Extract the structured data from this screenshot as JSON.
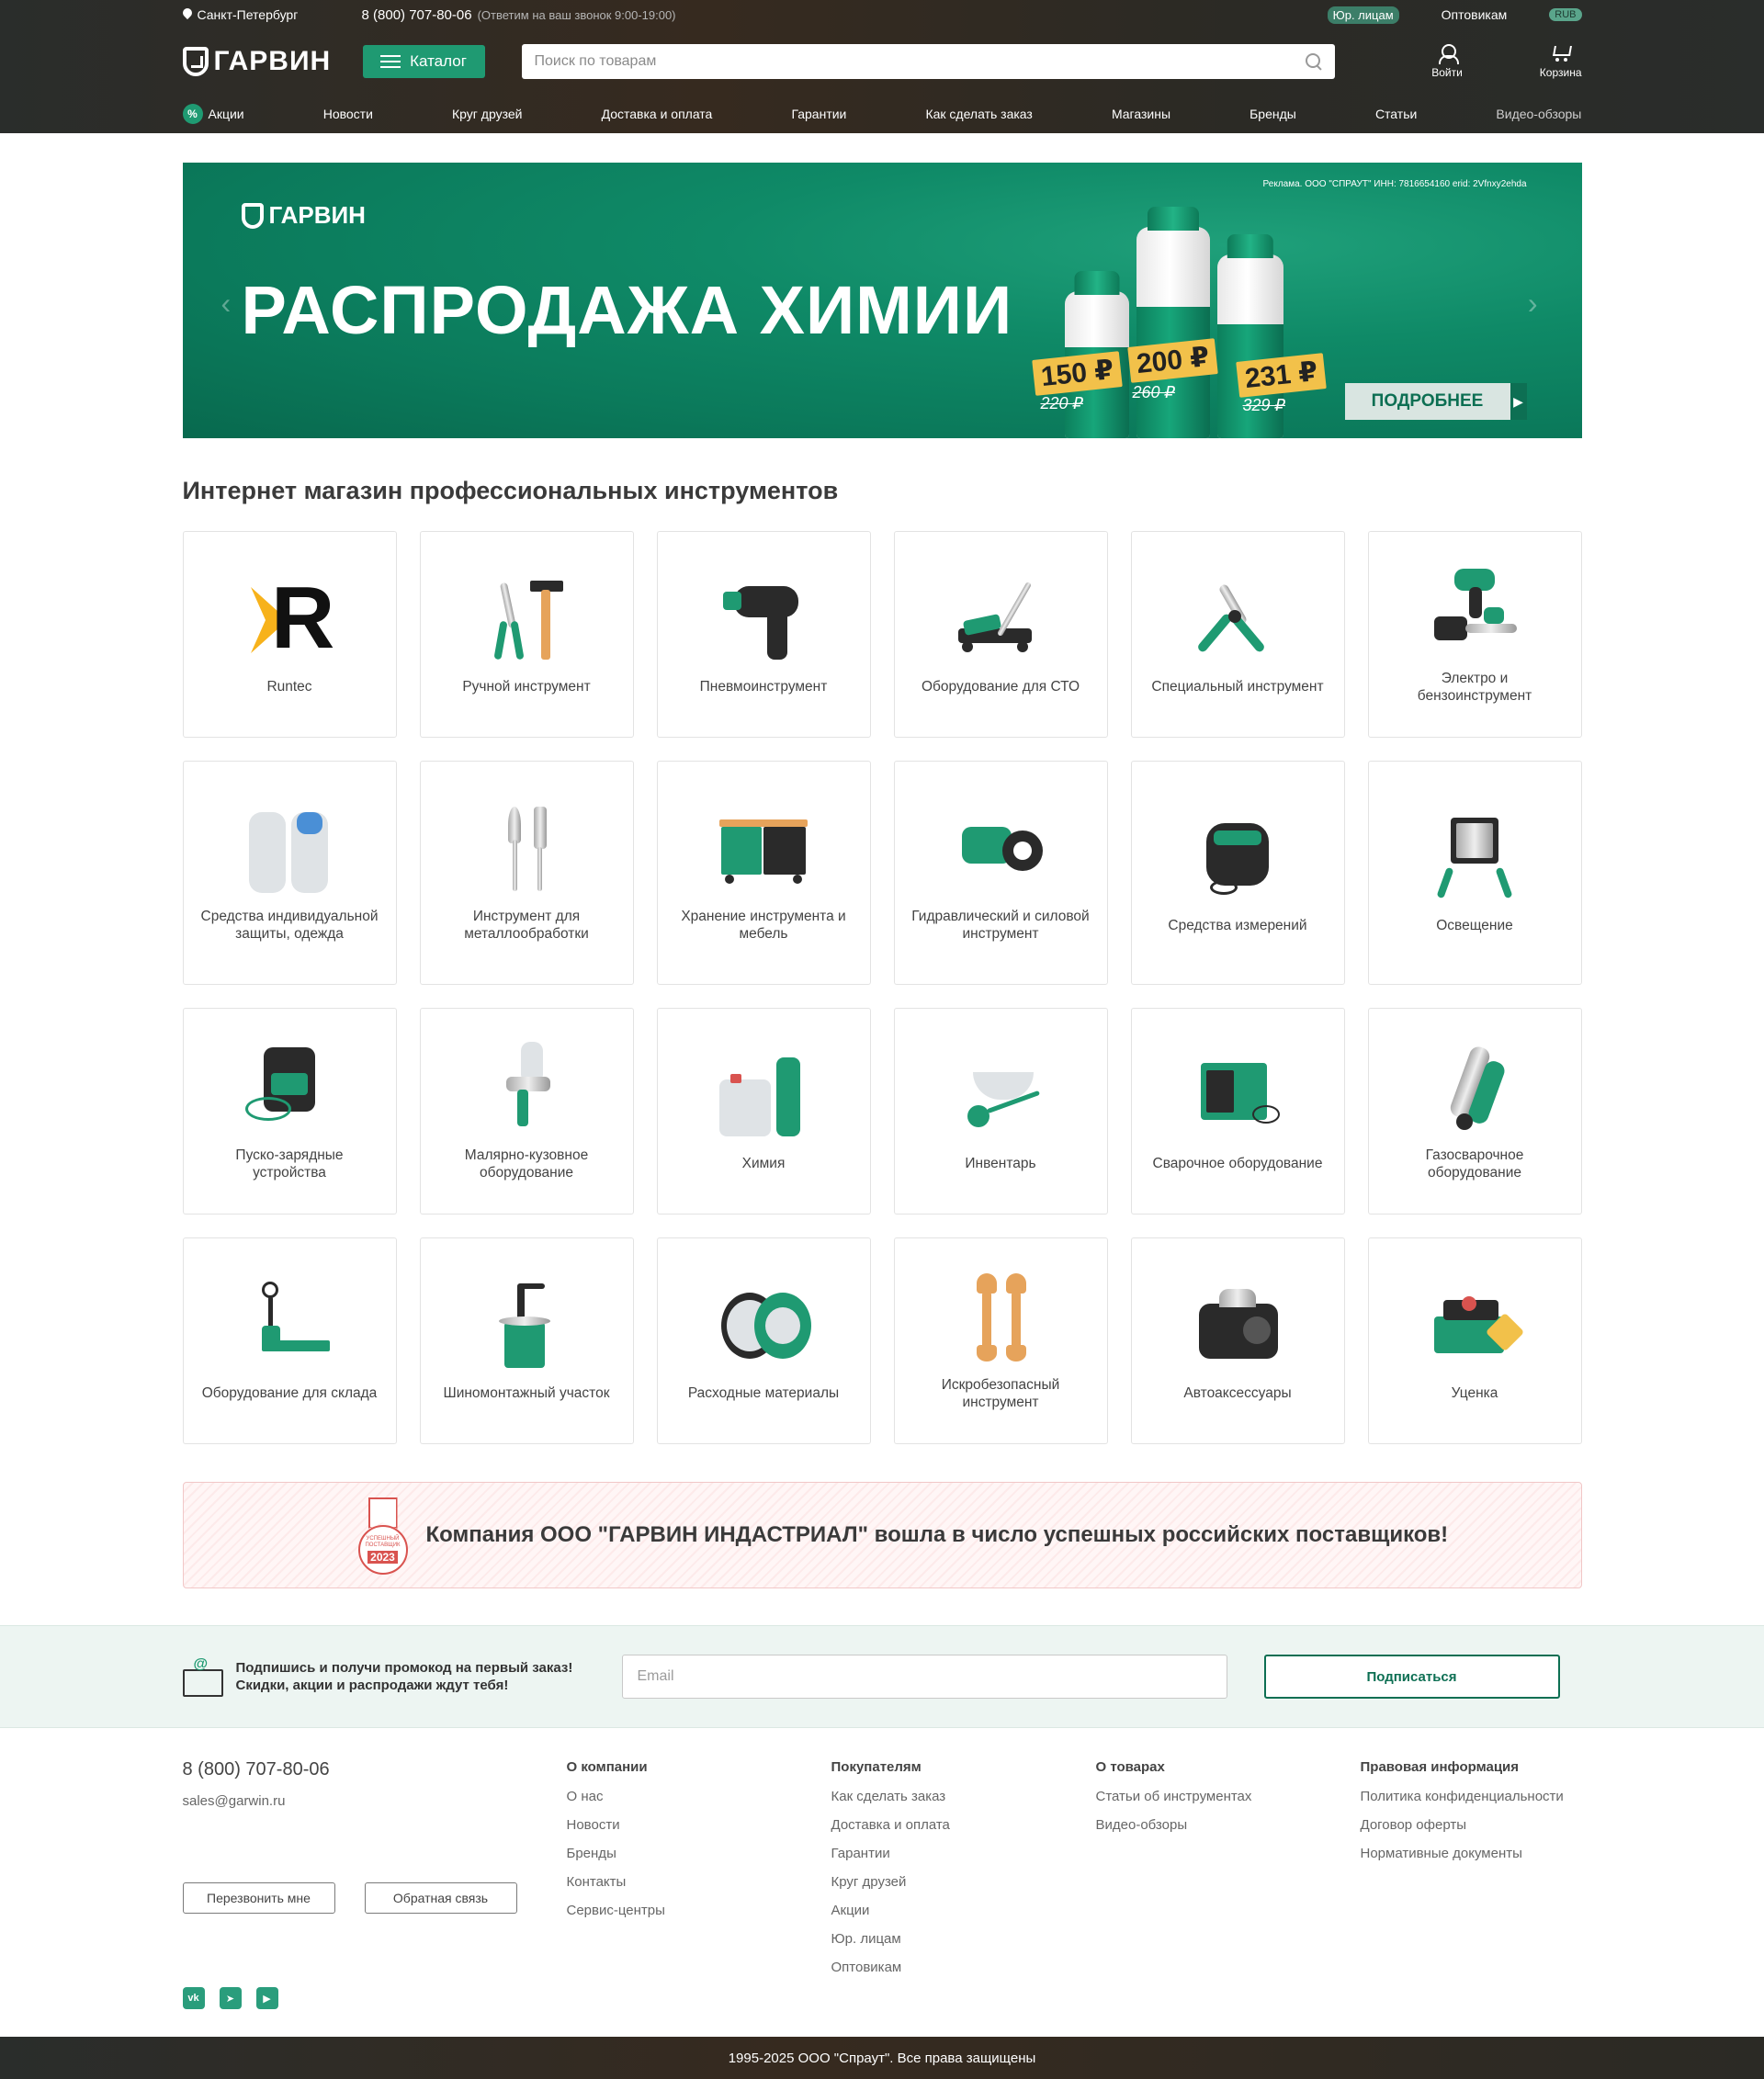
{
  "topbar": {
    "city": "Санкт-Петербург",
    "phone": "8 (800) 707-80-06",
    "phone_note": "(Ответим на ваш звонок 9:00-19:00)",
    "legal": "Юр. лицам",
    "wholesale": "Оптовикам",
    "currency": "RUB"
  },
  "header": {
    "logo": "ГАРВИН",
    "catalog": "Каталог",
    "search_placeholder": "Поиск по товарам",
    "login": "Войти",
    "cart": "Корзина"
  },
  "nav": [
    "Акции",
    "Новости",
    "Круг друзей",
    "Доставка и оплата",
    "Гарантии",
    "Как сделать заказ",
    "Магазины",
    "Бренды",
    "Статьи",
    "Видео-обзоры"
  ],
  "banner": {
    "logo": "ГАРВИН",
    "title": "РАСПРОДАЖА ХИМИИ",
    "ad_note": "Реклама. ООО \"СПРАУТ\" ИНН: 7816654160 erid: 2Vfnxy2ehda",
    "prices": [
      "150 ₽",
      "200 ₽",
      "231 ₽"
    ],
    "old_prices": [
      "220 ₽",
      "260 ₽",
      "329 ₽"
    ],
    "more": "ПОДРОБНЕЕ"
  },
  "main": {
    "heading": "Интернет магазин профессиональных инструментов",
    "categories": [
      "Runtec",
      "Ручной инструмент",
      "Пневмоинструмент",
      "Оборудование для СТО",
      "Специальный инструмент",
      "Электро и бензоинструмент",
      "Средства индивидуальной защиты, одежда",
      "Инструмент для металлообработки",
      "Хранение инструмента и мебель",
      "Гидравлический и силовой инструмент",
      "Средства измерений",
      "Освещение",
      "Пуско-зарядные устройства",
      "Малярно-кузовное оборудование",
      "Химия",
      "Инвентарь",
      "Сварочное оборудование",
      "Газосварочное оборудование",
      "Оборудование для склада",
      "Шиномонтажный участок",
      "Расходные материалы",
      "Искробезопасный инструмент",
      "Автоаксессуары",
      "Уценка"
    ]
  },
  "award": {
    "badge_text": "УСПЕШНЫЙ ПОСТАВЩИК",
    "year": "2023",
    "message": "Компания ООО \"ГАРВИН ИНДАСТРИАЛ\" вошла в число успешных российских поставщиков!"
  },
  "subscribe": {
    "text_line1": "Подпишись и получи промокод на первый заказ!",
    "text_line2": "Скидки, акции и распродажи ждут тебя!",
    "email_placeholder": "Email",
    "button": "Подписаться"
  },
  "footer": {
    "phone": "8 (800) 707-80-06",
    "email": "sales@garwin.ru",
    "callback": "Перезвонить мне",
    "feedback": "Обратная связь",
    "social": [
      "vk-icon",
      "telegram-icon",
      "youtube-icon"
    ],
    "columns": [
      {
        "title": "О компании",
        "links": [
          "О нас",
          "Новости",
          "Бренды",
          "Контакты",
          "Сервис-центры"
        ]
      },
      {
        "title": "Покупателям",
        "links": [
          "Как сделать заказ",
          "Доставка и оплата",
          "Гарантии",
          "Круг друзей",
          "Акции",
          "Юр. лицам",
          "Оптовикам"
        ]
      },
      {
        "title": "О товарах",
        "links": [
          "Статьи об инструментах",
          "Видео-обзоры"
        ]
      },
      {
        "title": "Правовая информация",
        "links": [
          "Политика конфиденциальности",
          "Договор оферты",
          "Нормативные документы"
        ]
      }
    ],
    "copyright": "1995-2025 ООО \"Спраут\". Все права защищены"
  },
  "colors": {
    "accent": "#1f9a72",
    "dark_green": "#0d6f53",
    "header_bg": "#2a2d2b",
    "price_yellow": "#f2c14a"
  }
}
